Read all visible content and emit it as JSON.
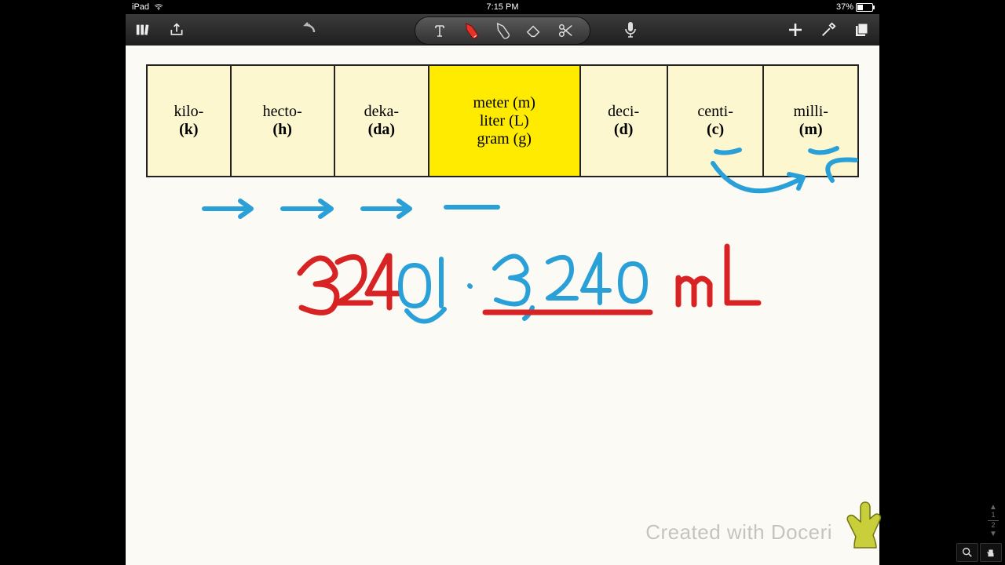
{
  "status": {
    "device": "iPad",
    "time": "7:15 PM",
    "battery_pct": "37%"
  },
  "toolbar": {
    "library": "library",
    "share": "share",
    "undo": "undo",
    "text": "text",
    "pen": "pen",
    "highlighter": "highlighter",
    "eraser": "eraser",
    "scissors": "scissors",
    "mic": "mic",
    "add": "add",
    "wrench": "wrench",
    "pages": "pages"
  },
  "table": {
    "cells": [
      {
        "prefix": "kilo-",
        "abbr": "(k)"
      },
      {
        "prefix": "hecto-",
        "abbr": "(h)"
      },
      {
        "prefix": "deka-",
        "abbr": "(da)"
      },
      {
        "prefix": "",
        "abbr": "",
        "base_lines": [
          "meter (m)",
          "liter (L)",
          "gram (g)"
        ]
      },
      {
        "prefix": "deci-",
        "abbr": "(d)"
      },
      {
        "prefix": "centi-",
        "abbr": "(c)"
      },
      {
        "prefix": "milli-",
        "abbr": "(m)"
      }
    ]
  },
  "handwriting": {
    "equation_left": "32401",
    "equation_right": "3,240",
    "unit": "mL"
  },
  "watermark": "Created with Doceri",
  "viewer": {
    "page_cur": "1",
    "page_total": "2"
  }
}
